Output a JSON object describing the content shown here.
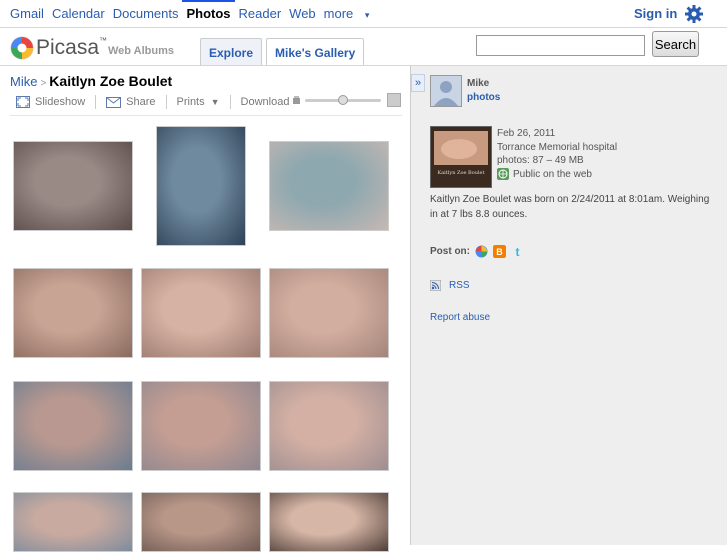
{
  "gbar": {
    "links": [
      "Gmail",
      "Calendar",
      "Documents",
      "Photos",
      "Reader",
      "Web",
      "more"
    ],
    "active": "Photos",
    "sign_in": "Sign in"
  },
  "header": {
    "logo_text": "Picasa",
    "logo_tm": "™",
    "subtitle": "Web Albums",
    "tabs": [
      "Explore",
      "Mike's Gallery"
    ],
    "selected_tab": "Mike's Gallery",
    "search_value": "",
    "search_button": "Search"
  },
  "breadcrumb": {
    "user": "Mike",
    "separator": ">",
    "album": "Kaitlyn Zoe Boulet"
  },
  "toolbar": {
    "slideshow": "Slideshow",
    "share": "Share",
    "prints": "Prints",
    "download": "Download",
    "zoom_level": 0.5
  },
  "photos": [
    {
      "row": 0,
      "col": 0,
      "kind": "landscape",
      "colors": [
        "#9a8a86",
        "#5a4a48"
      ]
    },
    {
      "row": 0,
      "col": 1,
      "kind": "portrait",
      "colors": [
        "#6f8a9f",
        "#2e4156"
      ]
    },
    {
      "row": 0,
      "col": 2,
      "kind": "landscape",
      "colors": [
        "#8ea8b0",
        "#c6b8b2"
      ]
    },
    {
      "row": 1,
      "col": 0,
      "kind": "landscape",
      "colors": [
        "#c8a494",
        "#8a6a60"
      ]
    },
    {
      "row": 1,
      "col": 1,
      "kind": "landscape",
      "colors": [
        "#d6b2a4",
        "#9c7a70"
      ]
    },
    {
      "row": 1,
      "col": 2,
      "kind": "landscape",
      "colors": [
        "#d2aea0",
        "#a4847a"
      ]
    },
    {
      "row": 2,
      "col": 0,
      "kind": "landscape",
      "colors": [
        "#b89890",
        "#6a7c90"
      ]
    },
    {
      "row": 2,
      "col": 1,
      "kind": "landscape",
      "colors": [
        "#c49e92",
        "#8e8690"
      ]
    },
    {
      "row": 2,
      "col": 2,
      "kind": "landscape",
      "colors": [
        "#d4b0a4",
        "#9e8e90"
      ]
    },
    {
      "row": 3,
      "col": 0,
      "kind": "landscape",
      "colors": [
        "#c8aaa0",
        "#7e8c9c"
      ]
    },
    {
      "row": 3,
      "col": 1,
      "kind": "landscape",
      "colors": [
        "#b89688",
        "#6e5a52"
      ]
    },
    {
      "row": 3,
      "col": 2,
      "kind": "landscape",
      "colors": [
        "#d6b6a6",
        "#4e3e38"
      ]
    }
  ],
  "sidebar": {
    "collapse_glyph": "»",
    "owner": "Mike",
    "owner_link": "photos",
    "album_date": "Feb 26, 2011",
    "album_location": "Torrance Memorial hospital",
    "album_stats": "photos: 87 – 49 MB",
    "album_visibility": "Public on the web",
    "cover_caption": "Kaitlyn Zoe Boulet",
    "description": "Kaitlyn Zoe Boulet was born on 2/24/2011 at 8:01am. Weighing in at 7 lbs 8.8 ounces.",
    "post_on_label": "Post on:",
    "post_on_services": [
      "google-buzz-icon",
      "blogger-icon",
      "twitter-icon"
    ],
    "rss": "RSS",
    "report": "Report abuse"
  },
  "colors": {
    "link": "#2a5db0",
    "sidebar_bg": "#eeeeee",
    "blogger": "#f57d00",
    "twitter": "#33b5e5"
  }
}
